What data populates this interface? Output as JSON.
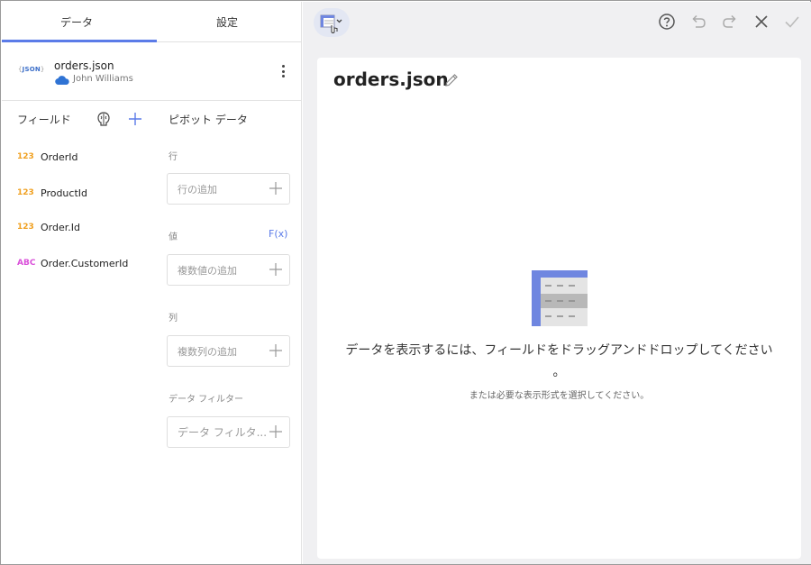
{
  "tabs": {
    "data_label": "データ",
    "settings_label": "設定"
  },
  "source": {
    "logo_text": "JSON",
    "name": "orders.json",
    "owner": "John Williams"
  },
  "fields": {
    "title": "フィールド",
    "items": [
      {
        "type": "123",
        "name": "OrderId"
      },
      {
        "type": "123",
        "name": "ProductId"
      },
      {
        "type": "123",
        "name": "Order.Id"
      },
      {
        "type": "ABC",
        "name": "Order.CustomerId"
      }
    ]
  },
  "pivot": {
    "title": "ピボット データ",
    "rows_label": "行",
    "rows_placeholder": "行の追加",
    "values_label": "値",
    "fx_label": "F(x)",
    "values_placeholder": "複数値の追加",
    "columns_label": "列",
    "columns_placeholder": "複数列の追加",
    "filter_label": "データ フィルター",
    "filter_placeholder": "データ フィルタ..."
  },
  "card": {
    "title": "orders.json",
    "empty_message": "データを表示するには、フィールドをドラッグアンドドロップしてください",
    "empty_message_tail": "。",
    "empty_sub": "または必要な表示形式を選択してください。"
  },
  "colors": {
    "accent": "#5b7be8",
    "number_type": "#f0a020",
    "text_type": "#d94fd9"
  },
  "icons": [
    "table-chart-icon",
    "help-icon",
    "undo-icon",
    "redo-icon",
    "close-icon",
    "check-icon",
    "pencil-icon",
    "brain-icon",
    "plus-icon",
    "cloud-icon",
    "kebab-menu-icon"
  ]
}
